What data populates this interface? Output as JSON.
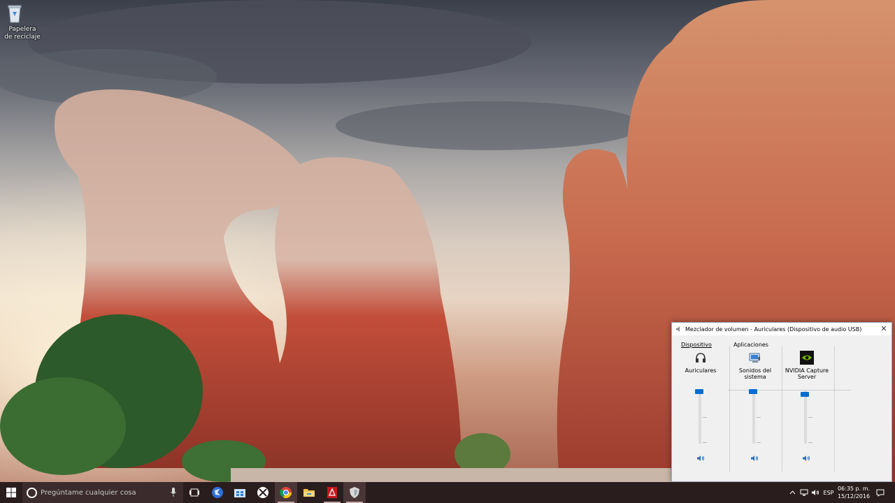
{
  "desktop": {
    "icons": [
      {
        "label": "Papelera de reciclaje",
        "icon": "recycle-bin-icon"
      }
    ]
  },
  "mixer": {
    "title": "Mezclador de volumen - Auriculares (Dispositivo de audio USB)",
    "group_device": "Dispositivo",
    "group_apps": "Aplicaciones",
    "channels": [
      {
        "label": "Auriculares",
        "icon": "headphones-icon",
        "level": 1.0
      },
      {
        "label": "Sonidos del sistema",
        "icon": "system-sounds-icon",
        "level": 1.0
      },
      {
        "label": "NVIDIA Capture Server",
        "icon": "nvidia-icon",
        "level": 0.95
      }
    ]
  },
  "taskbar": {
    "search_placeholder": "Pregúntame cualquier cosa",
    "apps": [
      "task-view-icon",
      "globe-browser-icon",
      "store-icon",
      "xbox-icon",
      "chrome-icon",
      "file-explorer-icon",
      "red-app-icon",
      "shield-app-icon"
    ],
    "tray": {
      "language": "ESP",
      "time": "06:35 p. m.",
      "date": "15/12/2016"
    }
  },
  "colors": {
    "accent": "#0a6ed1",
    "taskbar": "#2a1d1e"
  }
}
